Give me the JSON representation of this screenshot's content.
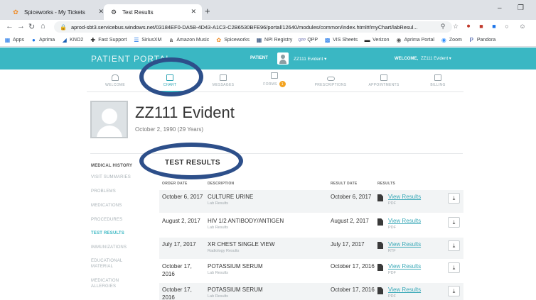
{
  "browser": {
    "tabs": [
      {
        "title": "Spiceworks - My Tickets"
      },
      {
        "title": "Test Results"
      }
    ],
    "url": "aprod-sbt3.servicebus.windows.net/03184EF0-DA5B-4D43-A1C3-C2B6530BFE96/portal/12640/modules/common/index.html#/myChart/labResul...",
    "bookmarks": [
      "Apps",
      "Aprima",
      "KNO2",
      "Fast Support",
      "SiriusXM",
      "Amazon Music",
      "Spiceworks",
      "NPI Registry",
      "QPP",
      "VIS Sheets",
      "Verizon",
      "Aprima Portal",
      "Zoom",
      "Pandora"
    ]
  },
  "portal": {
    "logo": "PATIENT PORTAL",
    "patient_label": "PATIENT",
    "patient_name": "ZZ111 Evident ▾",
    "welcome_label": "WELCOME,",
    "welcome_name": "ZZ111 Evident ▾"
  },
  "nav": {
    "items": [
      {
        "label": "WELCOME"
      },
      {
        "label": "CHART"
      },
      {
        "label": "MESSAGES"
      },
      {
        "label": "FORMS",
        "badge": "1"
      },
      {
        "label": "PRESCRIPTIONS"
      },
      {
        "label": "APPOINTMENTS"
      },
      {
        "label": "BILLING"
      }
    ]
  },
  "profile": {
    "name": "ZZ111 Evident",
    "dob": "October 2, 1990 (29 Years)"
  },
  "sidebar": {
    "title": "MEDICAL HISTORY",
    "items": [
      {
        "label": "VISIT SUMMARIES"
      },
      {
        "label": "PROBLEMS"
      },
      {
        "label": "MEDICATIONS"
      },
      {
        "label": "PROCEDURES"
      },
      {
        "label": "TEST RESULTS"
      },
      {
        "label": "IMMUNIZATIONS"
      },
      {
        "label": "EDUCATIONAL MATERIAL"
      },
      {
        "label": "MEDICATION ALLERGIES"
      }
    ]
  },
  "results": {
    "title": "TEST RESULTS",
    "columns": [
      "ORDER DATE",
      "DESCRIPTION",
      "RESULT DATE",
      "RESULTS"
    ],
    "rows": [
      {
        "order_date": "October 6, 2017",
        "description": "CULTURE URINE",
        "category": "Lab Results",
        "result_date": "October 6, 2017",
        "link": "View Results",
        "format": "PDF"
      },
      {
        "order_date": "August 2, 2017",
        "description": "HIV 1/2 ANTIBODY/ANTIGEN",
        "category": "Lab Results",
        "result_date": "August 2, 2017",
        "link": "View Results",
        "format": "PDF"
      },
      {
        "order_date": "July 17, 2017",
        "description": "XR CHEST SINGLE VIEW",
        "category": "Radiology Results",
        "result_date": "July 17, 2017",
        "link": "View Results",
        "format": "RTF"
      },
      {
        "order_date": "October 17, 2016",
        "description": "POTASSIUM SERUM",
        "category": "Lab Results",
        "result_date": "October 17, 2016",
        "link": "View Results",
        "format": "PDF"
      },
      {
        "order_date": "October 17, 2016",
        "description": "POTASSIUM SERUM",
        "category": "Lab Results",
        "result_date": "October 17, 2016",
        "link": "View Results",
        "format": "PDF"
      }
    ]
  },
  "colors": {
    "portal_bar": "#3ab7c3",
    "link": "#3aa9b8",
    "annotation": "#2d4f8a",
    "badge": "#f3a321"
  }
}
